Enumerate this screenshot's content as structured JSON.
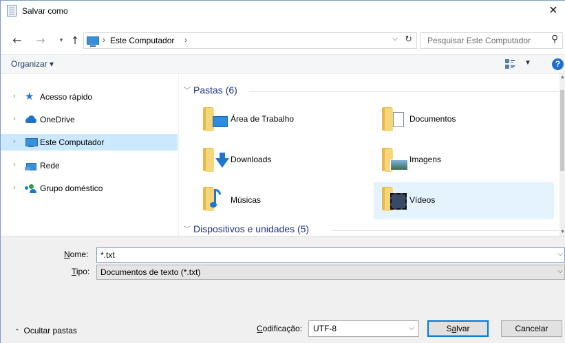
{
  "window": {
    "title": "Salvar como",
    "close_glyph": "✕"
  },
  "navigation": {
    "back_glyph": "←",
    "forward_glyph": "→",
    "recent_glyph": "⌄",
    "up_glyph": "↑",
    "address_segments": [
      "Este Computador"
    ],
    "address_separator": "›",
    "search_placeholder": "Pesquisar Este Computador"
  },
  "toolbar": {
    "organize_label": "Organizar ▾"
  },
  "sidebar": {
    "items": [
      {
        "label": "Acesso rápido",
        "icon": "star-icon",
        "selected": false
      },
      {
        "label": "OneDrive",
        "icon": "cloud-icon",
        "selected": false
      },
      {
        "label": "Este Computador",
        "icon": "computer-icon",
        "selected": true
      },
      {
        "label": "Rede",
        "icon": "network-icon",
        "selected": false
      },
      {
        "label": "Grupo doméstico",
        "icon": "homegroup-icon",
        "selected": false
      }
    ]
  },
  "content": {
    "groups": [
      {
        "header": "Pastas (6)",
        "expanded": true
      },
      {
        "header": "Dispositivos e unidades (5)",
        "expanded": true
      }
    ],
    "folders": [
      {
        "label": "Área de Trabalho",
        "icon": "desktop-folder-icon",
        "selected": false
      },
      {
        "label": "Documentos",
        "icon": "documents-folder-icon",
        "selected": false
      },
      {
        "label": "Downloads",
        "icon": "downloads-folder-icon",
        "selected": false
      },
      {
        "label": "Imagens",
        "icon": "pictures-folder-icon",
        "selected": false
      },
      {
        "label": "Músicas",
        "icon": "music-folder-icon",
        "selected": false
      },
      {
        "label": "Vídeos",
        "icon": "videos-folder-icon",
        "selected": true
      }
    ]
  },
  "form": {
    "name_label_key": "N",
    "name_label_rest": "ome:",
    "name_value": "*.txt",
    "type_label_key": "T",
    "type_label_rest": "ipo:",
    "type_value": "Documentos de texto (*.txt)",
    "hide_folders_label": "Ocultar pastas",
    "encoding_label_key": "C",
    "encoding_label_rest": "odificação:",
    "encoding_value": "UTF-8",
    "save_label_pre": "S",
    "save_label_key": "a",
    "save_label_post": "lvar",
    "cancel_label": "Cancelar"
  },
  "colors": {
    "accent": "#0078d7",
    "selection": "#cce8ff",
    "group_header": "#1e3287",
    "folder": "#f6d67a"
  }
}
